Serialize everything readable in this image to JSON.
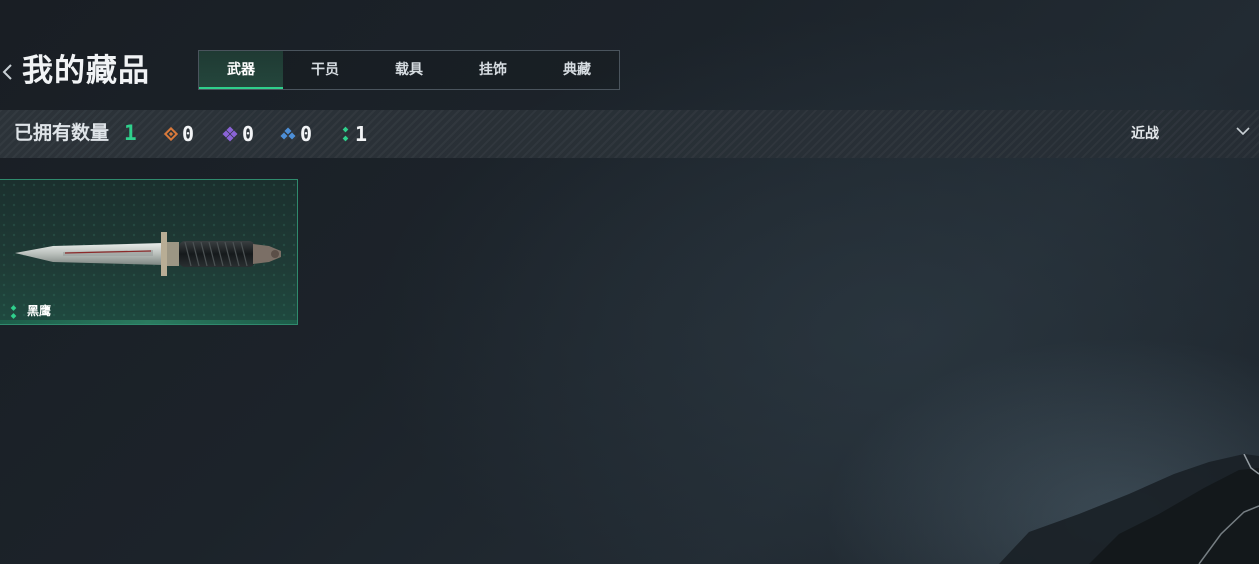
{
  "header": {
    "title": "我的藏品",
    "tabs": [
      {
        "label": "武器",
        "active": true
      },
      {
        "label": "干员",
        "active": false
      },
      {
        "label": "载具",
        "active": false
      },
      {
        "label": "挂饰",
        "active": false
      },
      {
        "label": "典藏",
        "active": false
      }
    ]
  },
  "stats": {
    "owned_label": "已拥有数量",
    "owned_count": "1",
    "rarities": [
      {
        "icon": "orange-diamond-icon",
        "color": "#d9793a",
        "count": "0"
      },
      {
        "icon": "purple-diamond-icon",
        "color": "#8a63d6",
        "count": "0"
      },
      {
        "icon": "blue-diamond-icon",
        "color": "#4d8fd8",
        "count": "0"
      },
      {
        "icon": "green-dots-icon",
        "color": "#2fd08c",
        "count": "1"
      }
    ]
  },
  "filter": {
    "selected": "近战"
  },
  "items": [
    {
      "name": "黑鹰",
      "rarity_color": "#2fd08c",
      "image": "knife-icon"
    }
  ],
  "colors": {
    "accent": "#2fd08c",
    "card_border": "#2f8a6d"
  }
}
